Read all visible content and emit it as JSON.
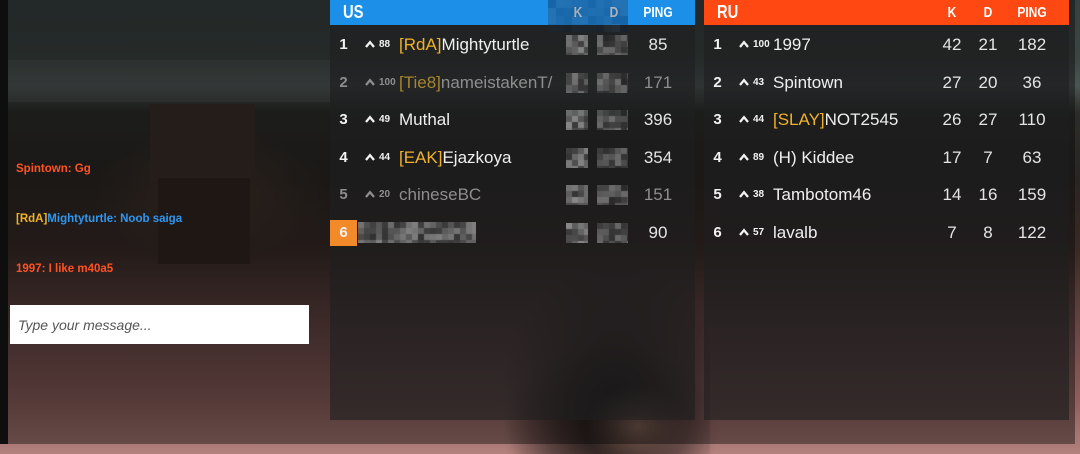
{
  "colors": {
    "clan_tag": "#f0b22a",
    "clan_tag_dimmed": "#a9852f",
    "dimmed_text": "#8e8e8e",
    "self_highlight": "#f28a2a"
  },
  "chat": {
    "messages": [
      {
        "text": "Spintown: Gg",
        "color": "#ff5224"
      },
      {
        "clan": "[RdA]",
        "text": "Mightyturtle: Noob saiga",
        "color": "#2f97f2"
      },
      {
        "text": "1997: I like m40a5",
        "color": "#ff5224"
      }
    ],
    "input_placeholder": "Type your message..."
  },
  "scoreboard": {
    "columns": {
      "kills": "K",
      "deaths": "D",
      "ping": "PING"
    },
    "teams": [
      {
        "name": "US",
        "color": "#1c8fe8",
        "stats_redacted": true,
        "players": [
          {
            "rank": "1",
            "level": "88",
            "clan": "[RdA]",
            "name": "Mightyturtle",
            "ping": "85"
          },
          {
            "rank": "2",
            "level": "100",
            "clan": "[Tie8]",
            "name": "nameistakenT/",
            "ping": "171",
            "dimmed": true
          },
          {
            "rank": "3",
            "level": "49",
            "name": "Muthal",
            "ping": "396"
          },
          {
            "rank": "4",
            "level": "44",
            "clan": "[EAK]",
            "name": "Ejazkoya",
            "ping": "354"
          },
          {
            "rank": "5",
            "level": "20",
            "name": "chineseBC",
            "ping": "151",
            "dimmed": true
          },
          {
            "rank": "6",
            "name_redacted": true,
            "ping": "90",
            "self": true
          }
        ]
      },
      {
        "name": "RU",
        "color": "#ff4812",
        "players": [
          {
            "rank": "1",
            "level": "100",
            "name": "1997",
            "kills": "42",
            "deaths": "21",
            "ping": "182"
          },
          {
            "rank": "2",
            "level": "43",
            "name": "Spintown",
            "kills": "27",
            "deaths": "20",
            "ping": "36"
          },
          {
            "rank": "3",
            "level": "44",
            "clan": "[SLAY]",
            "name": "NOT2545",
            "kills": "26",
            "deaths": "27",
            "ping": "110"
          },
          {
            "rank": "4",
            "level": "89",
            "name": "(H) Kiddee",
            "kills": "17",
            "deaths": "7",
            "ping": "63"
          },
          {
            "rank": "5",
            "level": "38",
            "name": "Tambotom46",
            "kills": "14",
            "deaths": "16",
            "ping": "159"
          },
          {
            "rank": "6",
            "level": "57",
            "name": "lavalb",
            "kills": "7",
            "deaths": "8",
            "ping": "122"
          }
        ]
      }
    ]
  }
}
